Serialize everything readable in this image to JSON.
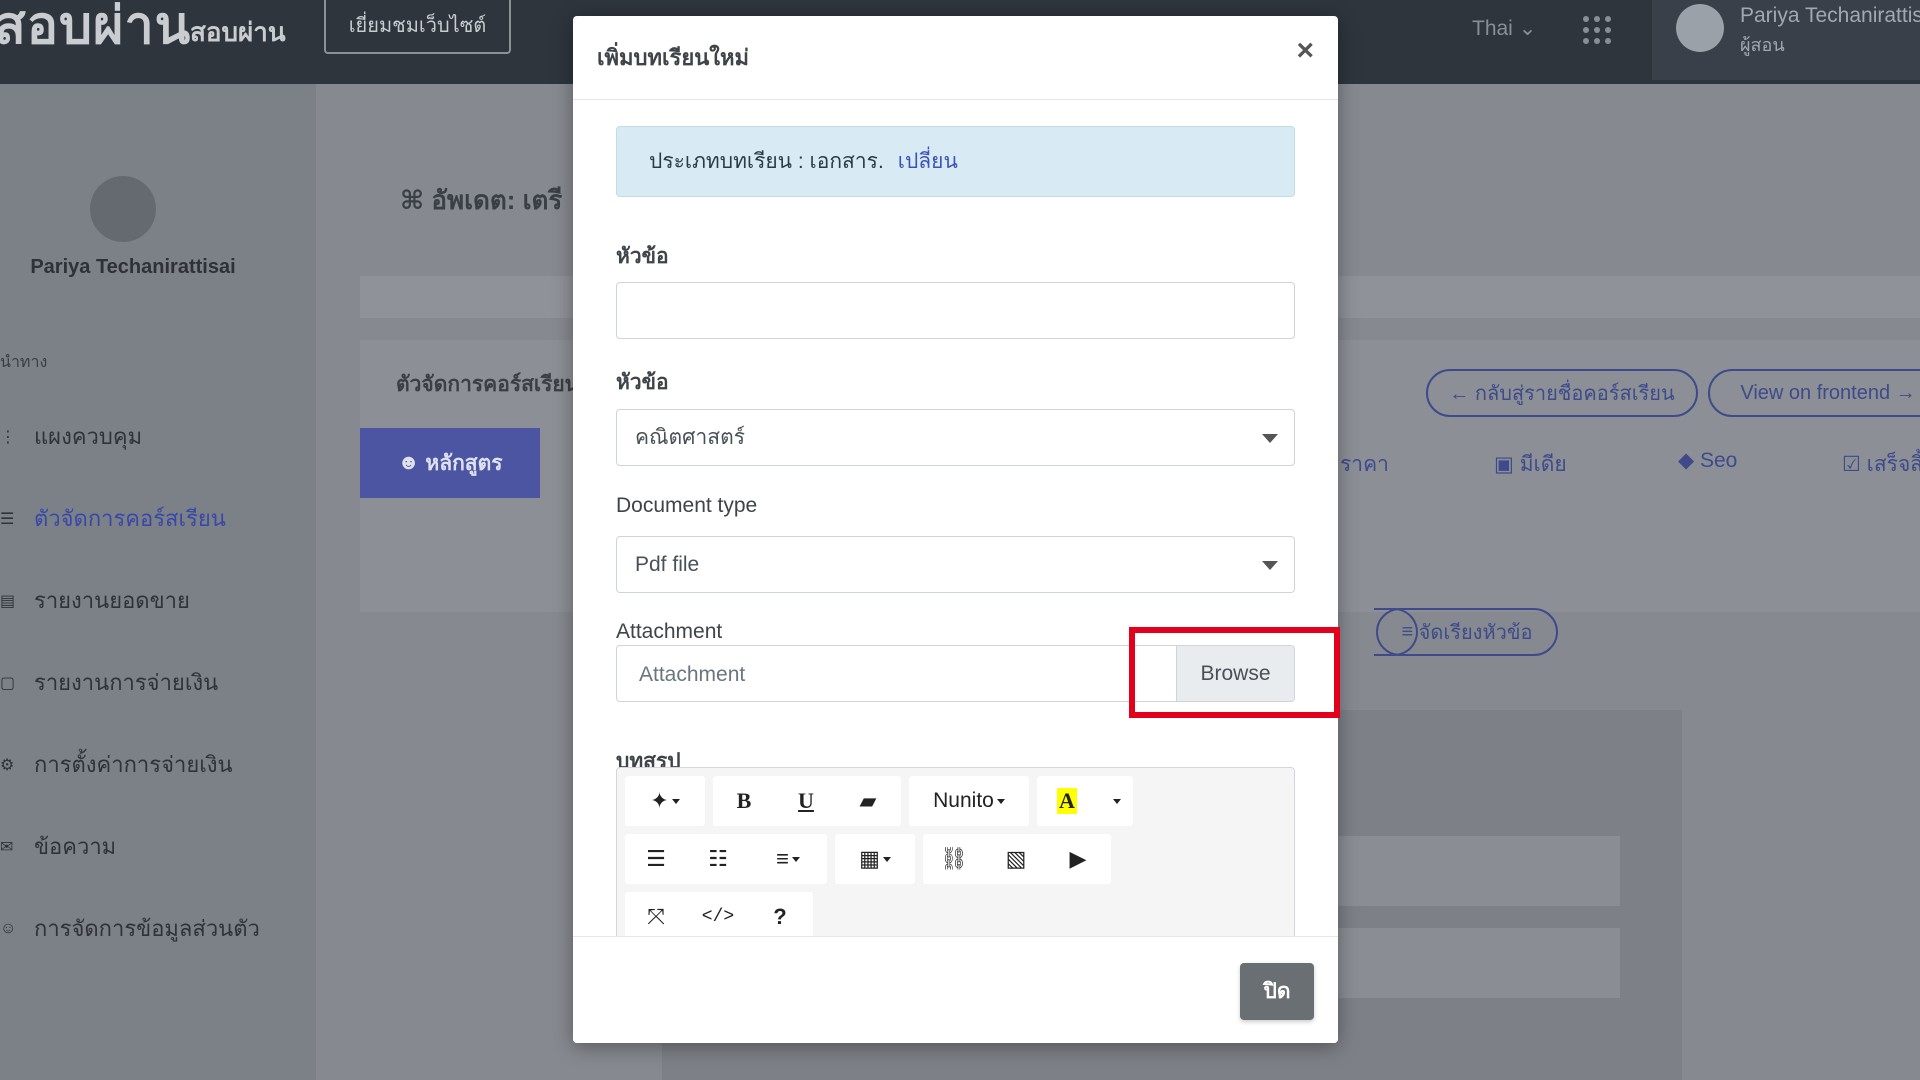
{
  "app": {
    "brand_logo": "สอบผ่าน",
    "brand_name": "สอบผ่าน",
    "visit_site": "เยี่ยมชมเว็บไซต์",
    "language": "Thai",
    "user_name": "Pariya Techanirattisai",
    "user_role": "ผู้สอน"
  },
  "sidebar": {
    "user_name": "Pariya Techanirattisai",
    "section_label": "นำทาง",
    "items": [
      {
        "label": "แผงควบคุม",
        "icon": "dashboard-icon"
      },
      {
        "label": "ตัวจัดการคอร์สเรียน",
        "icon": "course-icon",
        "active": true
      },
      {
        "label": "รายงานยอดขาย",
        "icon": "report-icon"
      },
      {
        "label": "รายงานการจ่ายเงิน",
        "icon": "payment-icon"
      },
      {
        "label": "การตั้งค่าการจ่ายเงิน",
        "icon": "settings-icon"
      },
      {
        "label": "ข้อความ",
        "icon": "message-icon"
      },
      {
        "label": "การจัดการข้อมูลส่วนตัว",
        "icon": "profile-icon"
      }
    ]
  },
  "content": {
    "page_title": "อัพเดต: เตรี",
    "course_manager": "ตัวจัดการคอร์สเรียน",
    "back_button": "← กลับสู่รายชื่อคอร์สเรียน",
    "view_frontend": "View on frontend →",
    "tabs": [
      "หลักสูตร",
      "ราคา",
      "มีเดีย",
      "Seo",
      "เสร็จสิ้น"
    ],
    "sort_button": "จัดเรียงหัวข้อ"
  },
  "modal": {
    "title": "เพิ่มบทเรียนใหม่",
    "close_symbol": "×",
    "alert_text": "ประเภทบทเรียน : เอกสาร.",
    "alert_link": "เปลี่ยน",
    "title_label": "หัวข้อ",
    "title_value": "",
    "section_label": "หัวข้อ",
    "section_value": "คณิตศาสตร์",
    "doc_type_label": "Document type",
    "doc_type_value": "Pdf file",
    "attachment_label": "Attachment",
    "attachment_placeholder": "Attachment",
    "browse_label": "Browse",
    "summary_label": "บทสรุป",
    "font_name": "Nunito",
    "footer_close": "ปิด"
  }
}
